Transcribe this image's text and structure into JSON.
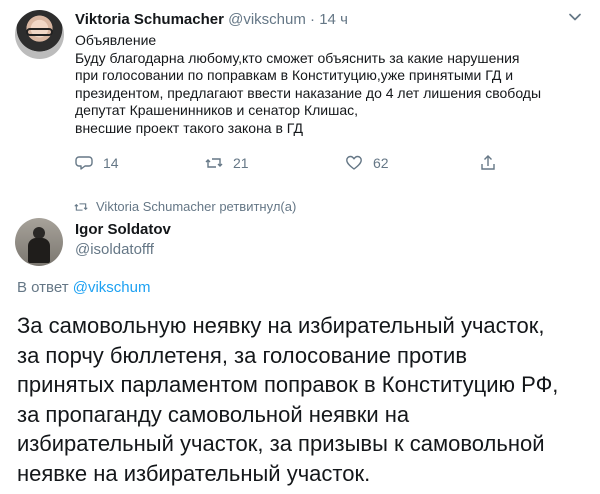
{
  "tweet1": {
    "name": "Viktoria Schumacher",
    "handle": "@vikschum",
    "separator": "·",
    "time": "14 ч",
    "lines": [
      "Объявление",
      "Буду благодарна любому,кто сможет объяснить за какие  нарушения",
      "при голосовании по поправкам в Конституцию,уже принятыми ГД и",
      "президентом, предлагают ввести наказание до 4 лет лишения свободы",
      "депутат Крашенинников и сенатор Клишас,",
      "внесшие проект такого закона в ГД"
    ],
    "reply_count": "14",
    "retweet_count": "21",
    "like_count": "62",
    "icons": {
      "reply": "reply-icon",
      "retweet": "retweet-icon",
      "like": "like-icon",
      "share": "share-icon",
      "menu": "chevron-down-icon"
    }
  },
  "retweet_note": {
    "text": "Viktoria Schumacher ретвитнул(а)",
    "icon": "retweet-icon"
  },
  "tweet2": {
    "name": "Igor Soldatov",
    "handle": "@isoldatofff",
    "reply_prefix": "В ответ",
    "reply_handle": "@vikschum",
    "lines": [
      "За самовольную неявку на избирательный участок,",
      "за порчу бюллетеня, за голосование против",
      "принятых парламентом поправок в Конституцию РФ,",
      "за пропаганду самовольной неявки на",
      "избирательный участок, за призывы к самовольной",
      "неявке на избирательный участок."
    ]
  },
  "colors": {
    "text": "#14171a",
    "muted": "#657786",
    "link": "#1da1f2"
  }
}
